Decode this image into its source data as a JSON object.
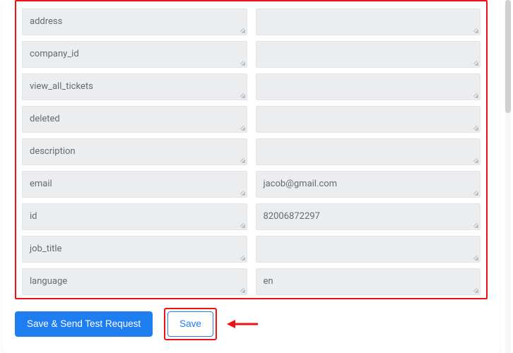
{
  "fields": [
    {
      "key": "address",
      "value": ""
    },
    {
      "key": "company_id",
      "value": ""
    },
    {
      "key": "view_all_tickets",
      "value": ""
    },
    {
      "key": "deleted",
      "value": ""
    },
    {
      "key": "description",
      "value": ""
    },
    {
      "key": "email",
      "value": "jacob@gmail.com"
    },
    {
      "key": "id",
      "value": "82006872297"
    },
    {
      "key": "job_title",
      "value": ""
    },
    {
      "key": "language",
      "value": "en"
    }
  ],
  "buttons": {
    "save_send": "Save & Send Test Request",
    "save": "Save"
  },
  "annotation": {
    "arrow_color": "#e11",
    "highlight_color": "#e11"
  },
  "scrollbar": {
    "thumb_top_pct": 0,
    "thumb_height_pct": 32
  }
}
